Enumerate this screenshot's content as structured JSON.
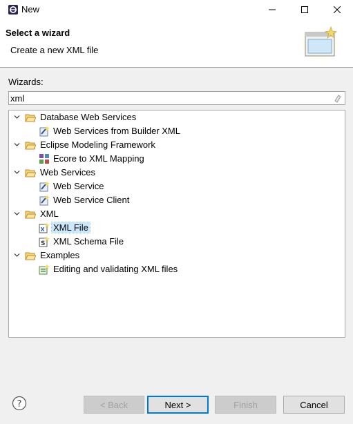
{
  "window": {
    "title": "New",
    "icon": "eclipse-icon"
  },
  "banner": {
    "title": "Select a wizard",
    "message": "Create a new XML file",
    "image": "new-wizard-banner-icon"
  },
  "wizards_label": "Wizards:",
  "filter": {
    "value": "xml",
    "clear_icon": "clear-field-icon"
  },
  "tree": {
    "rows": [
      {
        "label": "Database Web Services",
        "level": 0,
        "expanded": true,
        "icon": "folder-open-icon"
      },
      {
        "label": "Web Services from Builder XML",
        "level": 1,
        "icon": "web-service-wizard-icon"
      },
      {
        "label": "Eclipse Modeling Framework",
        "level": 0,
        "expanded": true,
        "icon": "folder-open-icon"
      },
      {
        "label": "Ecore to XML Mapping",
        "level": 1,
        "icon": "ecore-mapping-icon"
      },
      {
        "label": "Web Services",
        "level": 0,
        "expanded": true,
        "icon": "folder-open-icon"
      },
      {
        "label": "Web Service",
        "level": 1,
        "icon": "web-service-wizard-icon"
      },
      {
        "label": "Web Service Client",
        "level": 1,
        "icon": "web-service-wizard-icon"
      },
      {
        "label": "XML",
        "level": 0,
        "expanded": true,
        "icon": "folder-open-icon"
      },
      {
        "label": "XML File",
        "level": 1,
        "icon": "xml-file-icon",
        "selected": true
      },
      {
        "label": "XML Schema File",
        "level": 1,
        "icon": "xml-schema-file-icon"
      },
      {
        "label": "Examples",
        "level": 0,
        "expanded": true,
        "icon": "folder-open-icon"
      },
      {
        "label": "Editing and validating XML files",
        "level": 1,
        "icon": "example-project-icon"
      }
    ]
  },
  "buttons": {
    "help_icon": "help-icon",
    "back": "< Back",
    "next": "Next >",
    "finish": "Finish",
    "cancel": "Cancel"
  },
  "colors": {
    "selection": "#cce8ff",
    "default_button_border": "#0078d7",
    "folder": "#e8b84a"
  }
}
